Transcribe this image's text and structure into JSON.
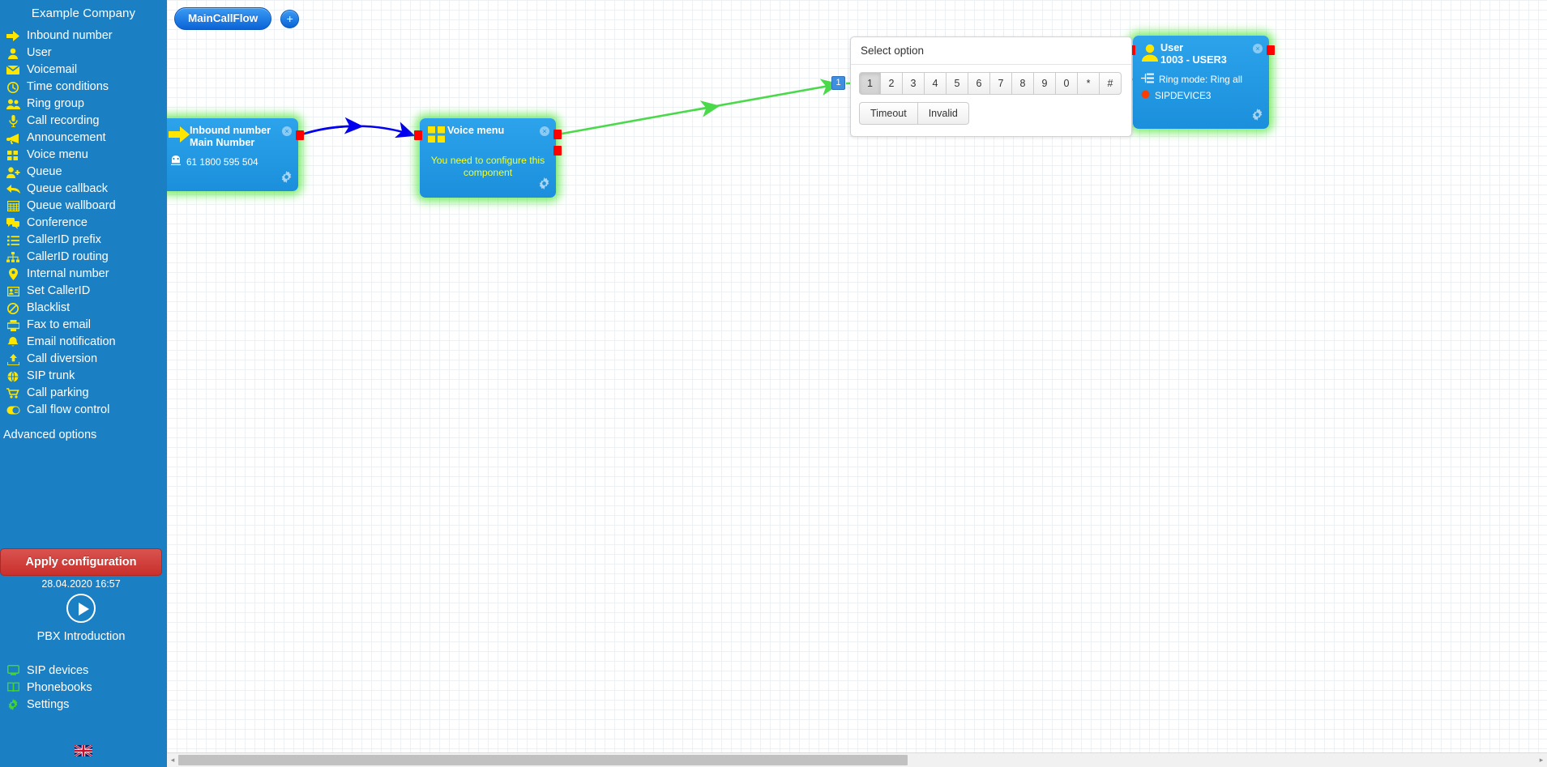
{
  "sidebar": {
    "company_title": "Example Company",
    "items": [
      {
        "label": "Inbound number",
        "icon": "arrow-right-icon"
      },
      {
        "label": "User",
        "icon": "user-icon"
      },
      {
        "label": "Voicemail",
        "icon": "envelope-icon"
      },
      {
        "label": "Time conditions",
        "icon": "clock-icon"
      },
      {
        "label": "Ring group",
        "icon": "users-group-icon"
      },
      {
        "label": "Call recording",
        "icon": "microphone-icon"
      },
      {
        "label": "Announcement",
        "icon": "megaphone-icon"
      },
      {
        "label": "Voice menu",
        "icon": "grid-squares-icon"
      },
      {
        "label": "Queue",
        "icon": "user-plus-icon"
      },
      {
        "label": "Queue callback",
        "icon": "reply-arrow-icon"
      },
      {
        "label": "Queue wallboard",
        "icon": "table-grid-icon"
      },
      {
        "label": "Conference",
        "icon": "speech-bubbles-icon"
      },
      {
        "label": "CallerID prefix",
        "icon": "list-icon"
      },
      {
        "label": "CallerID routing",
        "icon": "sitemap-icon"
      },
      {
        "label": "Internal number",
        "icon": "map-pin-icon"
      },
      {
        "label": "Set CallerID",
        "icon": "id-card-icon"
      },
      {
        "label": "Blacklist",
        "icon": "ban-icon"
      },
      {
        "label": "Fax to email",
        "icon": "fax-icon"
      },
      {
        "label": "Email notification",
        "icon": "bell-icon"
      },
      {
        "label": "Call diversion",
        "icon": "upload-arrow-icon"
      },
      {
        "label": "SIP trunk",
        "icon": "globe-icon"
      },
      {
        "label": "Call parking",
        "icon": "shopping-cart-icon"
      },
      {
        "label": "Call flow control",
        "icon": "toggle-switch-icon"
      }
    ],
    "advanced_options": "Advanced options",
    "apply_button": "Apply configuration",
    "apply_timestamp": "28.04.2020 16:57",
    "intro_label": "PBX Introduction",
    "bottom_items": [
      {
        "label": "SIP devices",
        "icon": "monitor-icon"
      },
      {
        "label": "Phonebooks",
        "icon": "book-icon"
      },
      {
        "label": "Settings",
        "icon": "gear-icon"
      }
    ],
    "language_flag": "uk-flag-icon"
  },
  "canvas": {
    "tabs": [
      {
        "label": "MainCallFlow",
        "active": true
      }
    ],
    "add_tab_label": "+",
    "link_badge_label": "1",
    "nodes": [
      {
        "id": "inbound-number",
        "title": "Inbound number",
        "subtitle": "Main Number",
        "detail": "61 1800 595 504",
        "detail_icon": "telephone-icon",
        "head_icon": "arrow-right-icon",
        "close_label": "×"
      },
      {
        "id": "voice-menu",
        "title": "Voice menu",
        "warning": "You need to configure this component",
        "head_icon": "grid-squares-icon",
        "close_label": "×"
      },
      {
        "id": "user",
        "title": "User",
        "subtitle": "1003 - USER3",
        "detail": "Ring mode: Ring all",
        "detail_icon": "ring-mode-icon",
        "device": "SIPDEVICE3",
        "device_icon": "red-dot-icon",
        "head_icon": "user-icon",
        "close_label": "×"
      }
    ]
  },
  "select_option_panel": {
    "title": "Select option",
    "digit_keys": [
      "1",
      "2",
      "3",
      "4",
      "5",
      "6",
      "7",
      "8",
      "9",
      "0",
      "*",
      "#"
    ],
    "active_digit": "1",
    "special_keys": [
      "Timeout",
      "Invalid"
    ]
  },
  "scrollbar": {
    "left_arrow": "◂",
    "right_arrow": "▸"
  },
  "colors": {
    "sidebar_bg": "#1b7fc4",
    "sidebar_icon": "#ffe600",
    "bottom_icon": "#44d62c",
    "node_bg": "#1b8fdb",
    "node_glow": "#50e63c",
    "apply_button": "#c9302c",
    "port": "#ff0000",
    "blue_link": "#0000ee",
    "green_link": "#4ad94a",
    "warning_text": "#f2ff2e"
  }
}
